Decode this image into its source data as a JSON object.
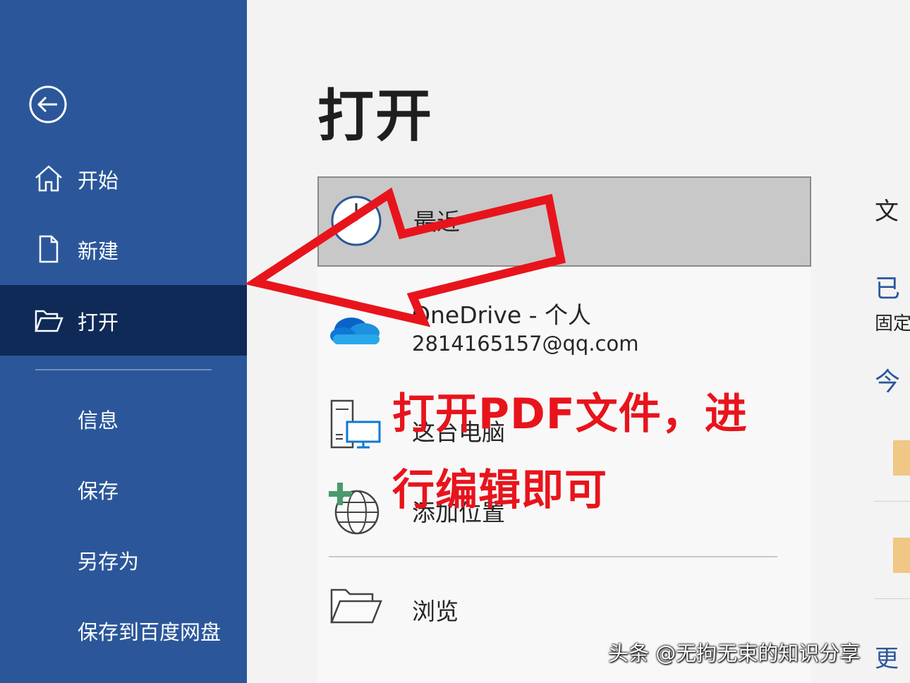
{
  "sidebar": {
    "back_icon": "back-arrow-circle-icon",
    "items": [
      {
        "label": "开始",
        "icon": "home-icon"
      },
      {
        "label": "新建",
        "icon": "new-document-icon"
      },
      {
        "label": "打开",
        "icon": "open-folder-icon",
        "active": true
      },
      {
        "label": "信息"
      },
      {
        "label": "保存"
      },
      {
        "label": "另存为"
      },
      {
        "label": "保存到百度网盘"
      }
    ],
    "bg_color": "#2b579a",
    "active_color": "#0f2a57"
  },
  "main": {
    "title": "打开",
    "locations": [
      {
        "label": "最近",
        "icon": "clock-icon",
        "selected": true
      },
      {
        "label": "OneDrive - 个人",
        "sub": "2814165157@qq.com",
        "icon": "onedrive-cloud-icon"
      },
      {
        "label": "这台电脑",
        "icon": "this-pc-icon"
      },
      {
        "label": "添加位置",
        "icon": "add-place-globe-icon"
      },
      {
        "label": "浏览",
        "icon": "browse-folder-icon"
      }
    ],
    "right_column": {
      "header": "文",
      "pinned_title": "已",
      "pinned_desc": "固定",
      "today": "今",
      "bottom": "更"
    }
  },
  "annotation": {
    "line1": "打开PDF文件，进",
    "line2": "行编辑即可",
    "color": "#e8141c"
  },
  "watermark": "头条 @无拘无束的知识分享"
}
